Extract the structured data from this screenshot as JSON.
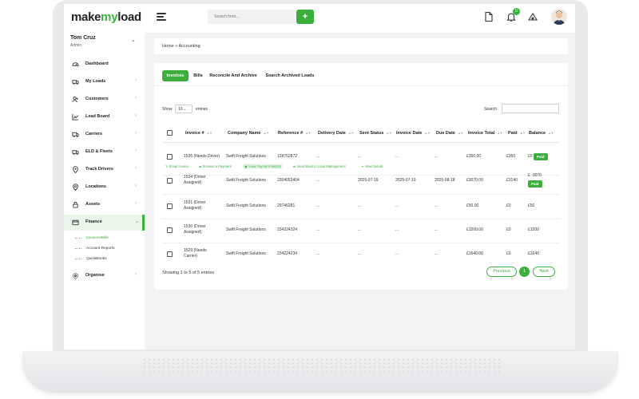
{
  "app": {
    "logo_text": "make",
    "logo_accent": "my",
    "logo_text2": "load"
  },
  "topbar": {
    "search_placeholder": "Search here...",
    "add_label": "+",
    "notification_count": "0"
  },
  "user": {
    "name": "Tom Cruz",
    "role": "Admin"
  },
  "sidebar": {
    "items": [
      {
        "label": "Dashboard",
        "icon": "dashboard-icon"
      },
      {
        "label": "My Loads",
        "icon": "truck-icon"
      },
      {
        "label": "Customers",
        "icon": "users-icon"
      },
      {
        "label": "Lead Board",
        "icon": "chart-icon"
      },
      {
        "label": "Carriers",
        "icon": "carrier-truck-icon"
      },
      {
        "label": "ELD & Fleets",
        "icon": "fleet-icon"
      },
      {
        "label": "Track Drivers",
        "icon": "location-pin-icon"
      },
      {
        "label": "Locations",
        "icon": "map-pin-icon"
      },
      {
        "label": "Assets",
        "icon": "lock-icon"
      },
      {
        "label": "Finance",
        "icon": "wallet-icon"
      },
      {
        "label": "Organise",
        "icon": "gear-icon"
      }
    ],
    "finance_sub": [
      "Invoices/Bills",
      "Account Reports",
      "QuickBooks"
    ]
  },
  "breadcrumb": {
    "home": "Home",
    "sep": "»",
    "current": "Accounting"
  },
  "tabs": [
    "Invoices",
    "Bills",
    "Reconcile And Archive",
    "Search Archived Loads"
  ],
  "table_controls": {
    "show": "Show",
    "entries_value": "10",
    "entries": "entries",
    "search": "Search:"
  },
  "columns": [
    "Invoice #",
    "Company Name",
    "Reference #",
    "Delivery Date",
    "Sent Status",
    "Invoice Date",
    "Due Date",
    "Invoice Total",
    "Paid",
    "Balance"
  ],
  "rows": [
    {
      "invoice": [
        "1535 (Needs Driver)"
      ],
      "company": "Swift Freight Solutions",
      "reference": "129752872",
      "delivery": "...",
      "sent": "...",
      "invoice_date": "...",
      "due": "...",
      "total": "£350.00",
      "paid": "£350",
      "balance": [
        "£0"
      ],
      "paid_badge": "Paid"
    },
    {
      "invoice": [
        "1534 (Driver",
        "Assigned)"
      ],
      "company": "Swift Freight Solutions",
      "reference": "2304053454",
      "delivery": "...",
      "sent": "2025-07-19",
      "invoice_date": "2025-07-19",
      "due": "2025-08-18",
      "total": "£3070.00",
      "paid": "£3140",
      "balance": [
        "£ -3070"
      ],
      "paid_badge": "Paid"
    },
    {
      "invoice": [
        "1531 (Driver",
        "Assigned)"
      ],
      "company": "Swift Freight Solutions",
      "reference": "29746281",
      "delivery": "...",
      "sent": "...",
      "invoice_date": "...",
      "due": "...",
      "total": "£50.00",
      "paid": "£0",
      "balance": [
        "£50"
      ],
      "paid_badge": ""
    },
    {
      "invoice": [
        "1530 (Driver",
        "Assigned)"
      ],
      "company": "Swift Freight Solutions",
      "reference": "234224324",
      "delivery": "...",
      "sent": "...",
      "invoice_date": "...",
      "due": "...",
      "total": "£1200.00",
      "paid": "£0",
      "balance": [
        "£1200"
      ],
      "paid_badge": ""
    },
    {
      "invoice": [
        "1529 (Needs",
        "Carrier)"
      ],
      "company": "Swift Freight Solutions",
      "reference": "234224234",
      "delivery": "...",
      "sent": "...",
      "invoice_date": "...",
      "due": "...",
      "total": "£1640.00",
      "paid": "£0",
      "balance": [
        "£1640"
      ],
      "paid_badge": ""
    }
  ],
  "row_actions": [
    "Email Invoice",
    "Receive a Payment",
    "View Payment History",
    "Send Back to Load Management",
    "View Details"
  ],
  "footer": {
    "showing": "Showing 1 to 5 of 5 entries",
    "previous": "Previous",
    "page": "1",
    "next": "Next"
  },
  "colors": {
    "accent": "#3cae3c"
  }
}
